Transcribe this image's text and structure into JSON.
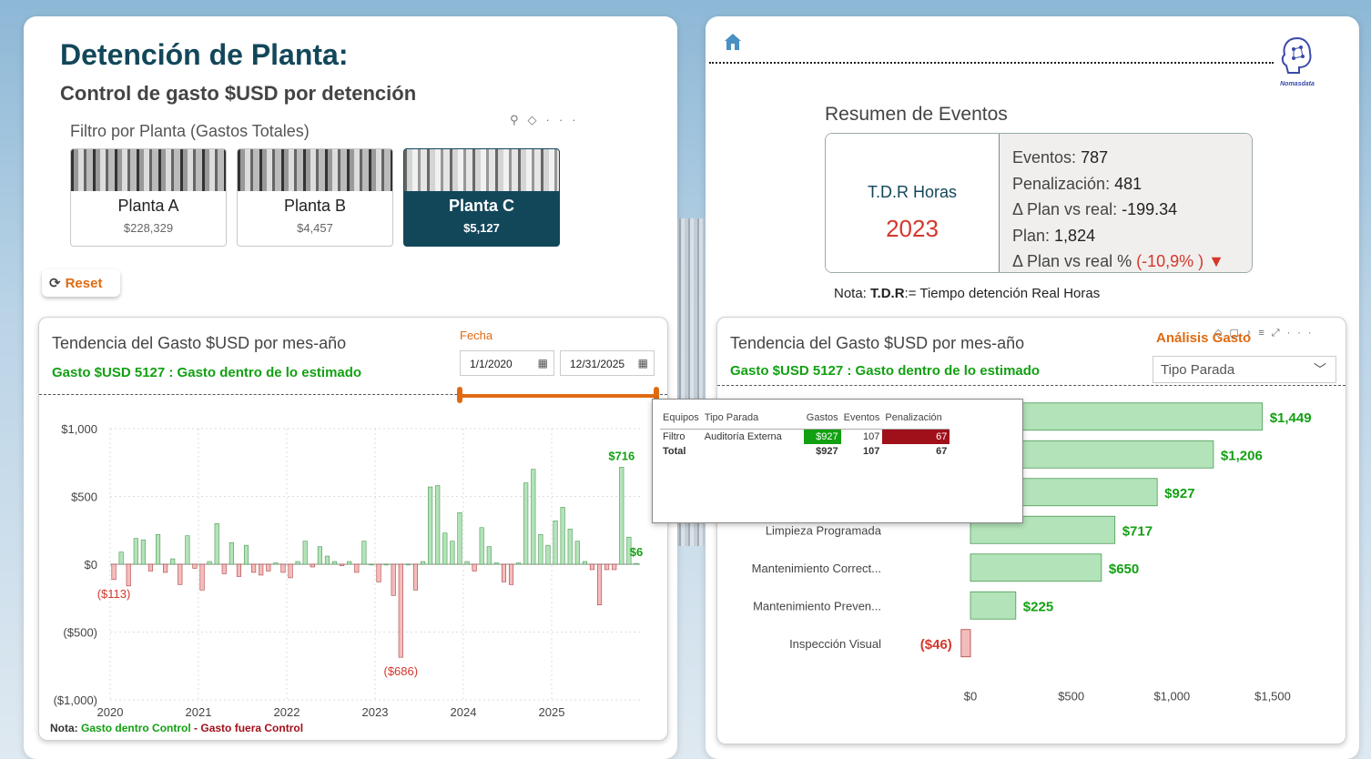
{
  "left": {
    "title": "Detención de Planta:",
    "subtitle": "Control de gasto $USD por detención",
    "filter_label": "Filtro por Planta (Gastos Totales)",
    "plants": [
      {
        "name": "Planta A",
        "value": "$228,329"
      },
      {
        "name": "Planta B",
        "value": "$4,457"
      },
      {
        "name": "Planta C",
        "value": "$5,127"
      }
    ],
    "reset_label": "Reset",
    "chart_title": "Tendencia del Gasto $USD por mes-año",
    "chart_subtitle": "Gasto $USD 5127 : Gasto dentro de lo estimado",
    "date_label": "Fecha",
    "date_from": "1/1/2020",
    "date_to": "12/31/2025",
    "note_prefix": "Nota:",
    "note_ok": "Gasto dentro Control",
    "note_sep": "-",
    "note_bad": "Gasto fuera Control"
  },
  "right": {
    "resumen_title": "Resumen de Eventos",
    "kpi_label": "T.D.R Horas",
    "kpi_year": "2023",
    "kpi_rows": [
      {
        "label": "Eventos:",
        "value": "787"
      },
      {
        "label": "Penalización:",
        "value": "481"
      },
      {
        "label": "Δ Plan vs real:",
        "value": "-199.34"
      },
      {
        "label": "Plan:",
        "value": "1,824"
      }
    ],
    "kpi_pct_label": "Δ Plan vs real %",
    "kpi_pct_value": "(-10,9% ) ▼",
    "tdr_note_prefix": "Nota:",
    "tdr_note_bold": "T.D.R",
    "tdr_note_rest": ":=  Tiempo detención Real Horas",
    "chart_title": "Tendencia del Gasto $USD por mes-año",
    "chart_subtitle": "Gasto $USD 5127 : Gasto dentro de lo estimado",
    "analisis_label": "Análisis Gasto",
    "select_value": "Tipo Parada",
    "logo_text": "Nomasdata"
  },
  "tooltip": {
    "headers": [
      "Equipos",
      "Tipo Parada",
      "Gastos",
      "Eventos",
      "Penalización"
    ],
    "row": [
      "Filtro",
      "Auditoría Externa",
      "$927",
      "107",
      "67"
    ],
    "total": [
      "Total",
      "",
      "$927",
      "107",
      "67"
    ]
  },
  "chart_data": [
    {
      "type": "bar",
      "title": "Tendencia del Gasto $USD por mes-año",
      "x_ticks": [
        "2020",
        "2021",
        "2022",
        "2023",
        "2024",
        "2025"
      ],
      "y_ticks": [
        "$1,000",
        "$500",
        "$0",
        "($500)",
        "($1,000)"
      ],
      "ylim": [
        -1000,
        1000
      ],
      "start": "2020-01",
      "values": [
        -113,
        90,
        -160,
        190,
        180,
        -50,
        220,
        -60,
        40,
        -150,
        210,
        -30,
        -190,
        20,
        300,
        -70,
        160,
        -90,
        140,
        -60,
        -80,
        -50,
        10,
        -60,
        -100,
        20,
        170,
        -20,
        130,
        60,
        20,
        -10,
        20,
        -60,
        170,
        0,
        -130,
        0,
        -230,
        -686,
        0,
        -190,
        20,
        570,
        580,
        230,
        170,
        380,
        20,
        -50,
        270,
        130,
        10,
        -130,
        -150,
        10,
        600,
        700,
        220,
        140,
        320,
        420,
        260,
        170,
        20,
        -40,
        -300,
        -40,
        -40,
        716,
        200,
        6
      ],
      "labels": [
        {
          "text": "($113)",
          "index": 0
        },
        {
          "text": "($686)",
          "index": 39
        },
        {
          "text": "$716",
          "index": 69
        },
        {
          "text": "$6",
          "index": 71
        }
      ],
      "grid": true
    },
    {
      "type": "bar",
      "orientation": "horizontal",
      "title": "Tendencia del Gasto $USD por mes-año",
      "categories": [
        "",
        "",
        "",
        "Limpieza Programada",
        "Mantenimiento Correct...",
        "Mantenimiento Preven...",
        "Inspección Visual"
      ],
      "values": [
        1449,
        1206,
        927,
        717,
        650,
        225,
        -46
      ],
      "value_labels": [
        "$1,449",
        "$1,206",
        "$927",
        "$717",
        "$650",
        "$225",
        "($46)"
      ],
      "x_ticks": [
        "$0",
        "$500",
        "$1,000",
        "$1,500"
      ],
      "xlim": [
        0,
        1500
      ]
    }
  ],
  "colors": {
    "positive_fill": "#b3e3b8",
    "negative_fill": "#f3bcbc",
    "positive_text": "#12a012",
    "negative_text": "#d4372c",
    "accent": "#e06a12",
    "brand": "#12475a"
  }
}
